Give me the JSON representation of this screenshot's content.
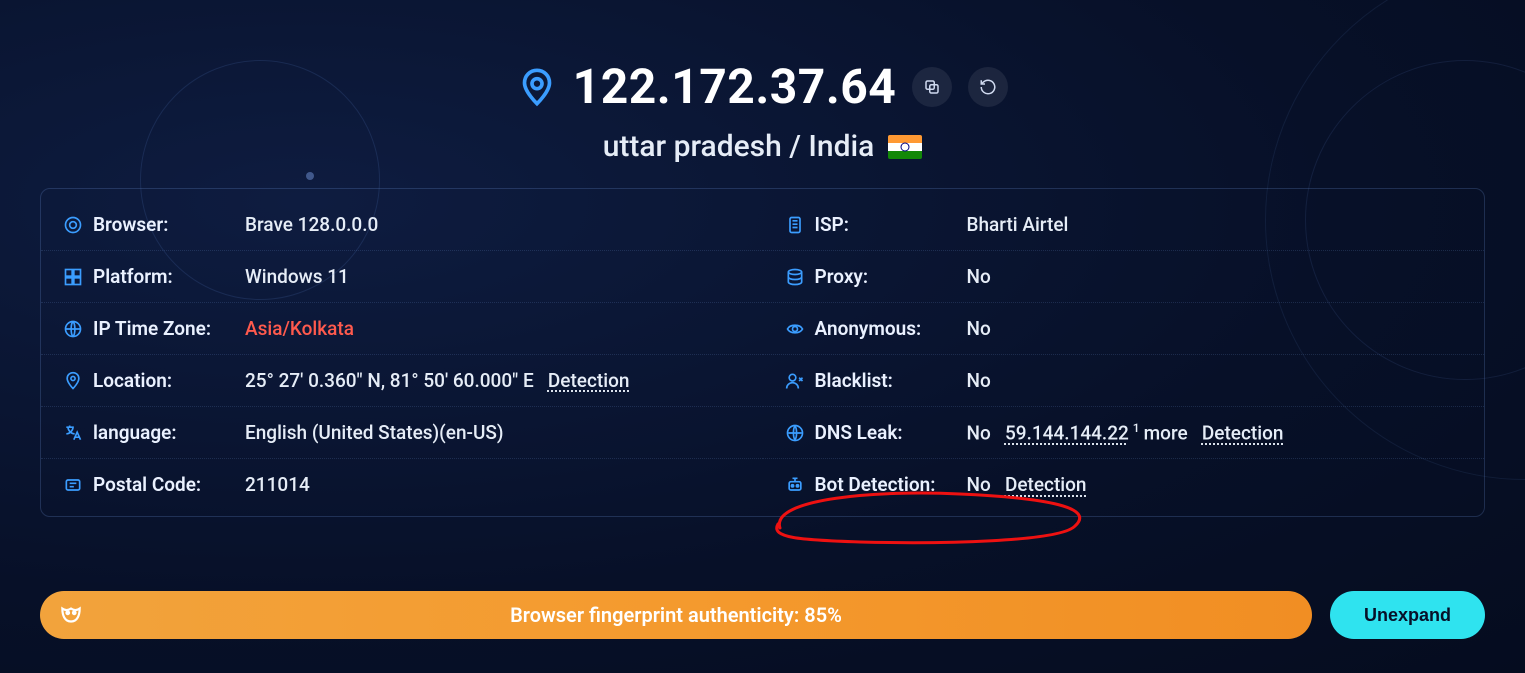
{
  "header": {
    "ip": "122.172.37.64",
    "location_text": "uttar pradesh / India",
    "flag_country": "India"
  },
  "left": {
    "browser": {
      "label": "Browser:",
      "value": "Brave 128.0.0.0"
    },
    "platform": {
      "label": "Platform:",
      "value": "Windows 11"
    },
    "timezone": {
      "label": "IP Time Zone:",
      "value": "Asia/Kolkata"
    },
    "location": {
      "label": "Location:",
      "value": "25° 27' 0.360\" N, 81° 50' 60.000\" E",
      "link": "Detection"
    },
    "language": {
      "label": "language:",
      "value": "English (United States)(en-US)"
    },
    "postal": {
      "label": "Postal Code:",
      "value": "211014"
    }
  },
  "right": {
    "isp": {
      "label": "ISP:",
      "value": "Bharti Airtel"
    },
    "proxy": {
      "label": "Proxy:",
      "value": "No"
    },
    "anonymous": {
      "label": "Anonymous:",
      "value": "No"
    },
    "blacklist": {
      "label": "Blacklist:",
      "value": "No"
    },
    "dnsleak": {
      "label": "DNS Leak:",
      "value": "No",
      "ip": "59.144.144.22",
      "more_sup": "1",
      "more_text": "more",
      "link": "Detection"
    },
    "bot": {
      "label": "Bot Detection:",
      "value": "No",
      "link": "Detection"
    }
  },
  "footer": {
    "fp_text": "Browser fingerprint authenticity: 85%",
    "unexpand": "Unexpand"
  }
}
